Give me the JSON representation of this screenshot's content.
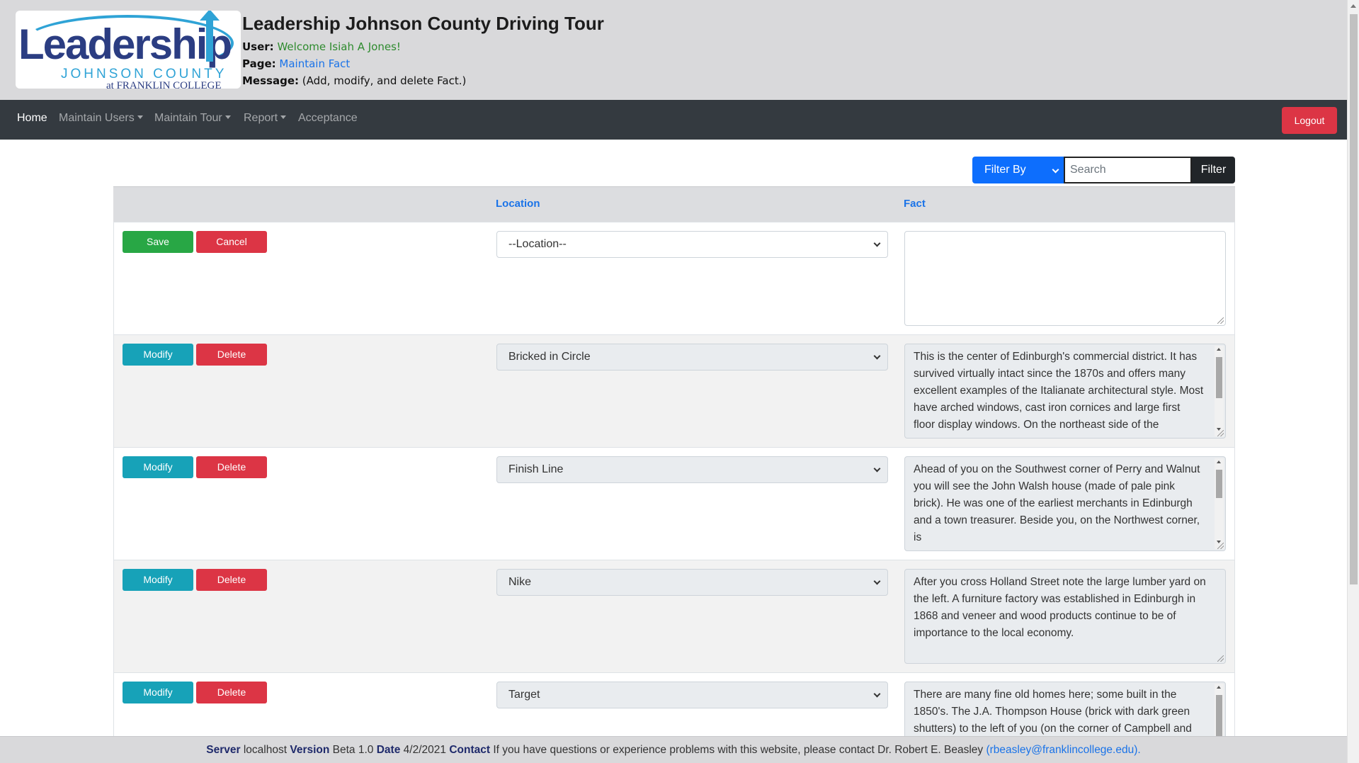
{
  "header": {
    "logo_word": "Leadership",
    "logo_county": "JOHNSON COUNTY",
    "logo_college": "at FRANKLIN COLLEGE",
    "title": "Leadership Johnson County Driving Tour",
    "user_label": "User:",
    "user_value": "Welcome Isiah A Jones!",
    "page_label": "Page:",
    "page_value": "Maintain Fact",
    "message_label": "Message:",
    "message_value": "(Add, modify, and delete Fact.)"
  },
  "nav": {
    "home": "Home",
    "maintain_users": "Maintain Users",
    "maintain_tour": "Maintain Tour",
    "report": "Report",
    "acceptance": "Acceptance",
    "logout": "Logout"
  },
  "filter": {
    "filter_by": "Filter By",
    "search_placeholder": "Search",
    "filter_button": "Filter"
  },
  "table": {
    "col_location": "Location",
    "col_fact": "Fact",
    "new_row": {
      "save": "Save",
      "cancel": "Cancel",
      "location": "--Location--",
      "fact": ""
    },
    "rows": [
      {
        "modify": "Modify",
        "delete": "Delete",
        "location": "Bricked in Circle",
        "fact": "This is the center of Edinburgh's commercial district. It has survived virtually intact since the 1870s and offers many excellent examples of the Italianate architectural style. Most have arched windows, cast iron cornices and large first floor display windows. On the northeast side of the"
      },
      {
        "modify": "Modify",
        "delete": "Delete",
        "location": "Finish Line",
        "fact": "Ahead of you on the Southwest corner of Perry and Walnut you will see the John Walsh house (made of pale pink brick).  He was one of the earliest merchants in Edinburgh and a town treasurer.  Beside you, on the Northwest corner, is"
      },
      {
        "modify": "Modify",
        "delete": "Delete",
        "location": "Nike",
        "fact": "After you cross Holland Street note the large lumber yard on the left.  A furniture factory was established in Edinburgh in 1868 and veneer and wood products continue to be of importance to the local economy."
      },
      {
        "modify": "Modify",
        "delete": "Delete",
        "location": "Target",
        "fact": "There are many fine old homes here; some built in the 1850's. The J.A. Thompson House (brick with dark green shutters) to the left of you (on the corner of Campbell and"
      }
    ]
  },
  "footer": {
    "server_label": "Server",
    "server_value": "localhost",
    "version_label": "Version",
    "version_value": "Beta 1.0",
    "date_label": "Date",
    "date_value": "4/2/2021",
    "contact_label": "Contact",
    "contact_text": "If you have questions or experience problems with this website, please contact Dr. Robert E. Beasley",
    "contact_email": "(rbeasley@franklincollege.edu)."
  }
}
